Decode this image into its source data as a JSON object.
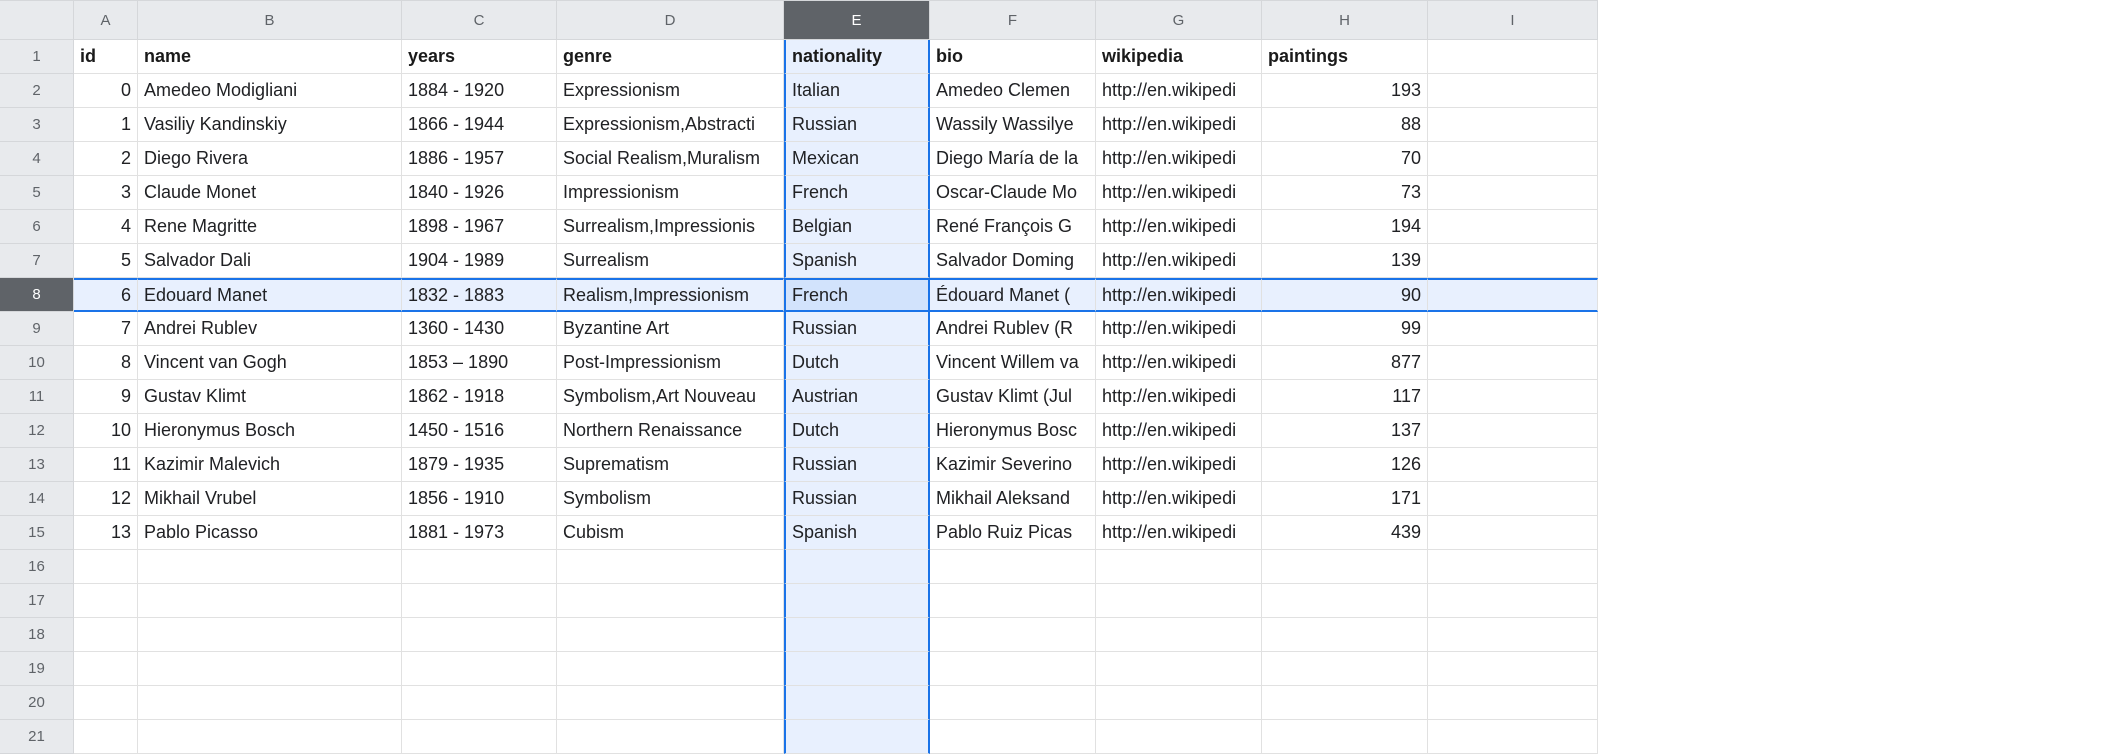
{
  "columns": [
    "A",
    "B",
    "C",
    "D",
    "E",
    "F",
    "G",
    "H",
    "I"
  ],
  "selectedColumnIndex": 4,
  "selectedRowIndex": 7,
  "rowCount": 21,
  "headerRow": {
    "id": "id",
    "name": "name",
    "years": "years",
    "genre": "genre",
    "nationality": "nationality",
    "bio": "bio",
    "wikipedia": "wikipedia",
    "paintings": "paintings"
  },
  "rows": [
    {
      "id": "0",
      "name": "Amedeo Modigliani",
      "years": "1884 - 1920",
      "genre": "Expressionism",
      "nationality": "Italian",
      "bio": "Amedeo Clemen",
      "wikipedia": "http://en.wikipedi",
      "paintings": "193"
    },
    {
      "id": "1",
      "name": "Vasiliy Kandinskiy",
      "years": "1866 - 1944",
      "genre": "Expressionism,Abstracti",
      "nationality": "Russian",
      "bio": "Wassily Wassilye",
      "wikipedia": "http://en.wikipedi",
      "paintings": "88"
    },
    {
      "id": "2",
      "name": "Diego Rivera",
      "years": "1886 - 1957",
      "genre": "Social Realism,Muralism",
      "nationality": "Mexican",
      "bio": "Diego María de la",
      "wikipedia": "http://en.wikipedi",
      "paintings": "70"
    },
    {
      "id": "3",
      "name": "Claude Monet",
      "years": "1840 - 1926",
      "genre": "Impressionism",
      "nationality": "French",
      "bio": "Oscar-Claude Mo",
      "wikipedia": "http://en.wikipedi",
      "paintings": "73"
    },
    {
      "id": "4",
      "name": "Rene Magritte",
      "years": "1898 - 1967",
      "genre": "Surrealism,Impressionis",
      "nationality": "Belgian",
      "bio": "René François G",
      "wikipedia": "http://en.wikipedi",
      "paintings": "194"
    },
    {
      "id": "5",
      "name": "Salvador Dali",
      "years": "1904 - 1989",
      "genre": "Surrealism",
      "nationality": "Spanish",
      "bio": "Salvador Doming",
      "wikipedia": "http://en.wikipedi",
      "paintings": "139"
    },
    {
      "id": "6",
      "name": "Edouard Manet",
      "years": "1832 - 1883",
      "genre": "Realism,Impressionism",
      "nationality": "French",
      "bio": "Édouard Manet (",
      "wikipedia": "http://en.wikipedi",
      "paintings": "90"
    },
    {
      "id": "7",
      "name": "Andrei Rublev",
      "years": "1360 - 1430",
      "genre": "Byzantine Art",
      "nationality": "Russian",
      "bio": "Andrei Rublev (R",
      "wikipedia": "http://en.wikipedi",
      "paintings": "99"
    },
    {
      "id": "8",
      "name": "Vincent van Gogh",
      "years": "1853 – 1890",
      "genre": "Post-Impressionism",
      "nationality": "Dutch",
      "bio": "Vincent Willem va",
      "wikipedia": "http://en.wikipedi",
      "paintings": "877"
    },
    {
      "id": "9",
      "name": "Gustav Klimt",
      "years": "1862 - 1918",
      "genre": "Symbolism,Art Nouveau",
      "nationality": "Austrian",
      "bio": "Gustav Klimt (Jul",
      "wikipedia": "http://en.wikipedi",
      "paintings": "117"
    },
    {
      "id": "10",
      "name": "Hieronymus Bosch",
      "years": "1450 - 1516",
      "genre": "Northern Renaissance",
      "nationality": "Dutch",
      "bio": "Hieronymus Bosc",
      "wikipedia": "http://en.wikipedi",
      "paintings": "137"
    },
    {
      "id": "11",
      "name": "Kazimir Malevich",
      "years": "1879 - 1935",
      "genre": "Suprematism",
      "nationality": "Russian",
      "bio": "Kazimir Severino",
      "wikipedia": "http://en.wikipedi",
      "paintings": "126"
    },
    {
      "id": "12",
      "name": "Mikhail Vrubel",
      "years": "1856 - 1910",
      "genre": "Symbolism",
      "nationality": "Russian",
      "bio": "Mikhail Aleksand",
      "wikipedia": "http://en.wikipedi",
      "paintings": "171"
    },
    {
      "id": "13",
      "name": "Pablo Picasso",
      "years": "1881 - 1973",
      "genre": "Cubism",
      "nationality": "Spanish",
      "bio": "Pablo Ruiz Picas",
      "wikipedia": "http://en.wikipedi",
      "paintings": "439"
    }
  ]
}
